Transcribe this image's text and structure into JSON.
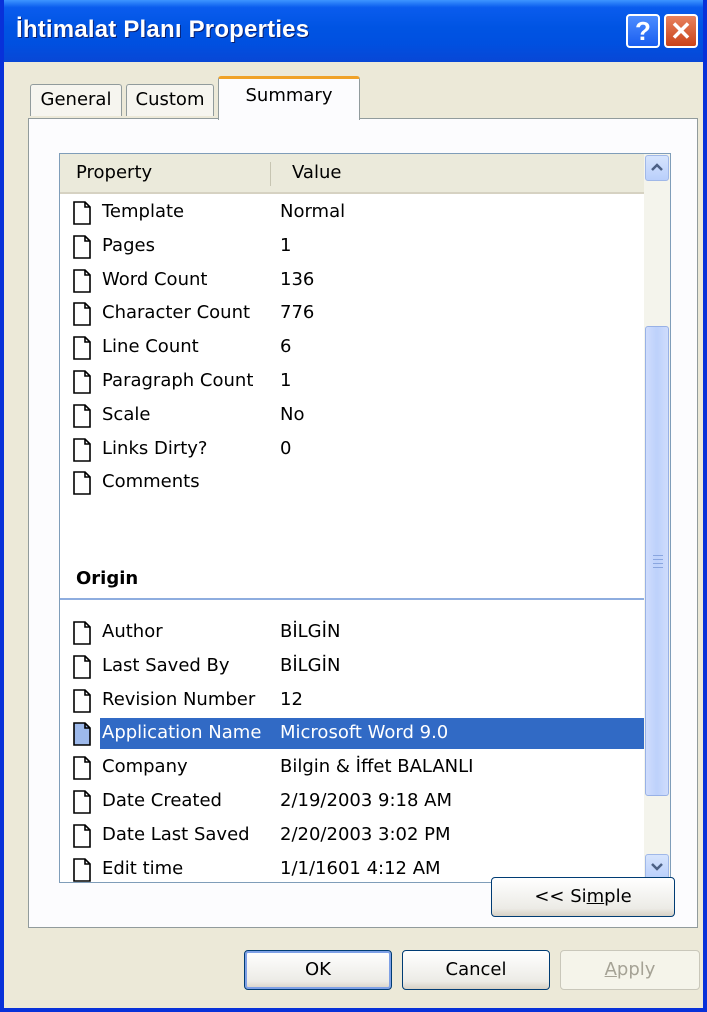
{
  "window": {
    "title": "İhtimalat Planı Properties",
    "help_glyph": "?",
    "close_glyph": "✕"
  },
  "tabs": [
    {
      "label": "General",
      "selected": false
    },
    {
      "label": "Custom",
      "selected": false
    },
    {
      "label": "Summary",
      "selected": true
    }
  ],
  "list": {
    "columns": [
      "Property",
      "Value"
    ],
    "group_title": "Origin",
    "rows": [
      {
        "name": "Template",
        "value": "Normal"
      },
      {
        "name": "Pages",
        "value": "1"
      },
      {
        "name": "Word Count",
        "value": "136"
      },
      {
        "name": "Character Count",
        "value": "776"
      },
      {
        "name": "Line Count",
        "value": "6"
      },
      {
        "name": "Paragraph Count",
        "value": "1"
      },
      {
        "name": "Scale",
        "value": "No"
      },
      {
        "name": "Links Dirty?",
        "value": "0"
      },
      {
        "name": "Comments",
        "value": ""
      }
    ],
    "origin_rows": [
      {
        "name": "Author",
        "value": "BİLGİN"
      },
      {
        "name": "Last Saved By",
        "value": "BİLGİN"
      },
      {
        "name": "Revision Number",
        "value": "12"
      },
      {
        "name": "Application Name",
        "value": "Microsoft Word 9.0",
        "selected": true
      },
      {
        "name": "Company",
        "value": "Bilgin & İffet BALANLI"
      },
      {
        "name": "Date Created",
        "value": "2/19/2003 9:18 AM"
      },
      {
        "name": "Date Last Saved",
        "value": "2/20/2003 3:02 PM"
      },
      {
        "name": "Edit time",
        "value": "1/1/1601 4:12 AM"
      }
    ]
  },
  "buttons": {
    "simple": {
      "pre": "<< Si",
      "mnemonic": "m",
      "post": "ple"
    },
    "ok": "OK",
    "cancel": "Cancel",
    "apply": {
      "mnemonic": "A",
      "post": "pply",
      "enabled": false
    }
  },
  "colors": {
    "title_bar": "#0054e3",
    "selection": "#316ac5",
    "tab_highlight": "#f0a228"
  }
}
